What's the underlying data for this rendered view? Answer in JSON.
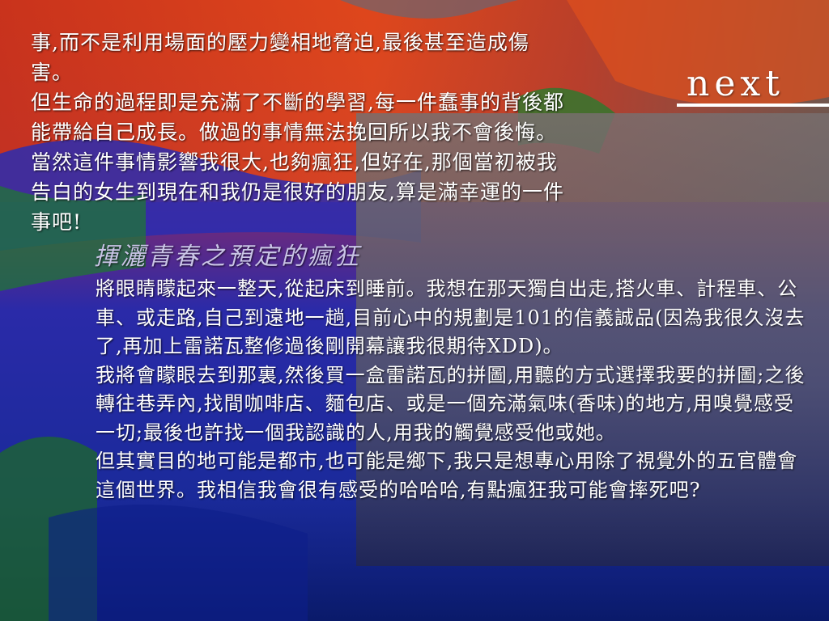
{
  "nav": {
    "next_label": "next"
  },
  "intro": {
    "paragraphs": [
      "事,而不是利用場面的壓力變相地脅迫,最後甚至造成傷害。",
      "但生命的過程即是充滿了不斷的學習,每一件蠢事的背後都能帶給自己成長。做過的事情無法挽回所以我不會後悔。當然這件事情影響我很大,也夠瘋狂,但好在,那個當初被我告白的女生到現在和我仍是很好的朋友,算是滿幸運的一件事吧!"
    ]
  },
  "section": {
    "title": "揮灑青春之預定的瘋狂",
    "paragraphs": [
      "將眼睛矇起來一整天,從起床到睡前。我想在那天獨自出走,搭火車、計程車、公車、或走路,自己到遠地一趟,目前心中的規劃是101的信義誠品(因為我很久沒去了,再加上雷諾瓦整修過後剛開幕讓我很期待XDD)。",
      "我將會矇眼去到那裏,然後買一盒雷諾瓦的拼圖,用聽的方式選擇我要的拼圖;之後轉往巷弄內,找間咖啡店、麵包店、或是一個充滿氣味(香味)的地方,用嗅覺感受一切;最後也許找一個我認識的人,用我的觸覺感受他或她。",
      "但其實目的地可能是都市,也可能是鄉下,我只是想專心用除了視覺外的五官體會這個世界。我相信我會很有感受的哈哈哈,有點瘋狂我可能會摔死吧?"
    ]
  },
  "colors": {
    "text": "#ffffff",
    "subtitle": "#c9c4e6",
    "bg_red": "#d8321c",
    "bg_blue": "#1f2aa8",
    "bg_green": "#1f6e2c"
  }
}
